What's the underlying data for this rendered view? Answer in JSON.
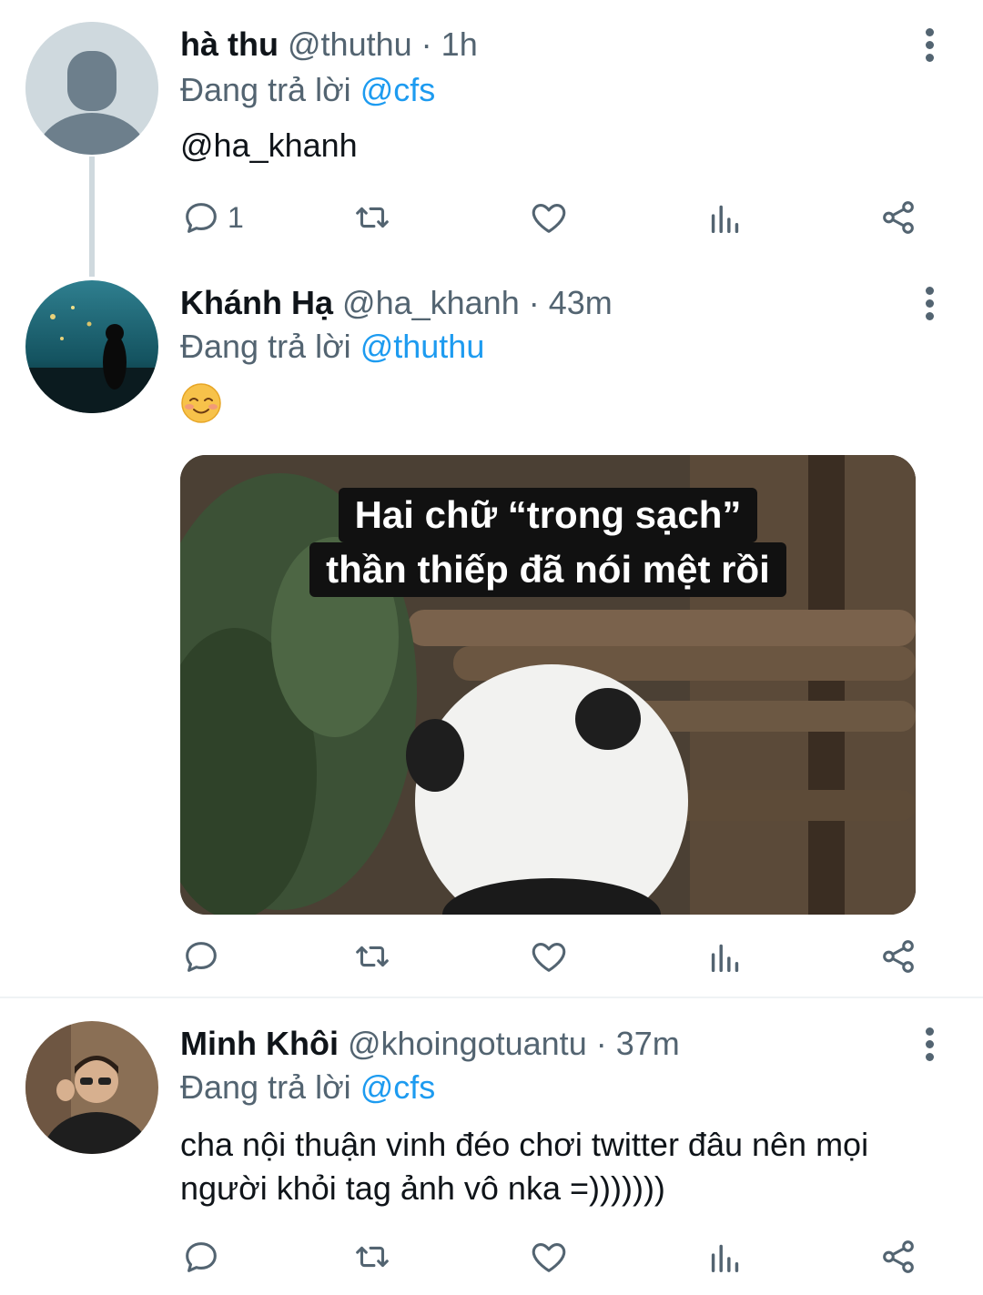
{
  "tweets": [
    {
      "name": "hà thu",
      "handle": "@thuthu",
      "dot": "·",
      "time": "1h",
      "reply_prefix": "Đang trả lời",
      "reply_to": "@cfs",
      "text": "@ha_khanh",
      "reply_count": "1"
    },
    {
      "name": "Khánh Hạ",
      "handle": "@ha_khanh",
      "dot": "·",
      "time": "43m",
      "reply_prefix": "Đang trả lời",
      "reply_to": "@thuthu",
      "text": "☺️",
      "media_caption_line1": "Hai chữ “trong sạch”",
      "media_caption_line2": "thần thiếp đã nói mệt rồi",
      "reply_count": ""
    },
    {
      "name": "Minh Khôi",
      "handle": "@khoingotuantu",
      "dot": "·",
      "time": "37m",
      "reply_prefix": "Đang trả lời",
      "reply_to": "@cfs",
      "text_line1": "cha nội thuận vinh đéo chơi twitter đâu nên mọi",
      "text_line2": "người khỏi tag ảnh vô nka =)))))))",
      "reply_count": ""
    }
  ],
  "icons": {
    "reply": "reply-icon",
    "retweet": "retweet-icon",
    "like": "heart-icon",
    "views": "analytics-icon",
    "share": "share-icon",
    "more": "more-vertical-icon"
  },
  "colors": {
    "accent": "#1d9bf0",
    "muted": "#536471",
    "text": "#0f1419"
  }
}
